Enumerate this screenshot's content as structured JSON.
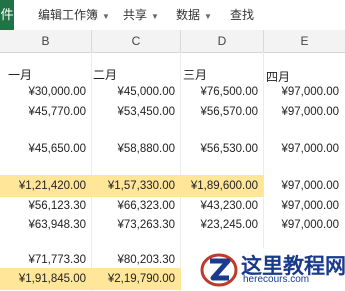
{
  "ribbon": {
    "app_tab": "件",
    "menus": [
      {
        "label": "编辑工作簿"
      },
      {
        "label": "共享"
      },
      {
        "label": "数据"
      },
      {
        "label": "查找"
      }
    ]
  },
  "columns": [
    "B",
    "C",
    "D",
    "E"
  ],
  "months": [
    "一月",
    "二月",
    "三月",
    "四月"
  ],
  "rows": [
    {
      "values": [
        "¥30,000.00",
        "¥45,000.00",
        "¥76,500.00",
        "¥97,000.00"
      ],
      "highlight": [
        false,
        false,
        false,
        false
      ]
    },
    {
      "values": [
        "¥45,770.00",
        "¥53,450.00",
        "¥56,570.00",
        "¥97,000.00"
      ],
      "highlight": [
        false,
        false,
        false,
        false
      ]
    },
    {
      "values": [
        "¥45,650.00",
        "¥58,880.00",
        "¥56,530.00",
        "¥97,000.00"
      ],
      "highlight": [
        false,
        false,
        false,
        false
      ]
    },
    {
      "values": [
        "¥1,21,420.00",
        "¥1,57,330.00",
        "¥1,89,600.00",
        "¥97,000.00"
      ],
      "highlight": [
        true,
        true,
        true,
        false
      ]
    },
    {
      "values": [
        "¥56,123.30",
        "¥66,323.00",
        "¥43,230.00",
        "¥97,000.00"
      ],
      "highlight": [
        false,
        false,
        false,
        false
      ]
    },
    {
      "values": [
        "¥63,948.30",
        "¥73,263.30",
        "¥23,245.00",
        "¥97,000.00"
      ],
      "highlight": [
        false,
        false,
        false,
        false
      ]
    },
    {
      "values": [
        "¥71,773.30",
        "¥80,203.30",
        "",
        ""
      ],
      "highlight": [
        false,
        false,
        false,
        false
      ]
    },
    {
      "values": [
        "¥1,91,845.00",
        "¥2,19,790.00",
        "",
        ""
      ],
      "highlight": [
        true,
        true,
        false,
        false
      ]
    }
  ],
  "watermark": {
    "title": "这里教程网",
    "url": "herecours.com"
  },
  "colors": {
    "highlight": "#ffe699",
    "app_green": "#217346"
  }
}
